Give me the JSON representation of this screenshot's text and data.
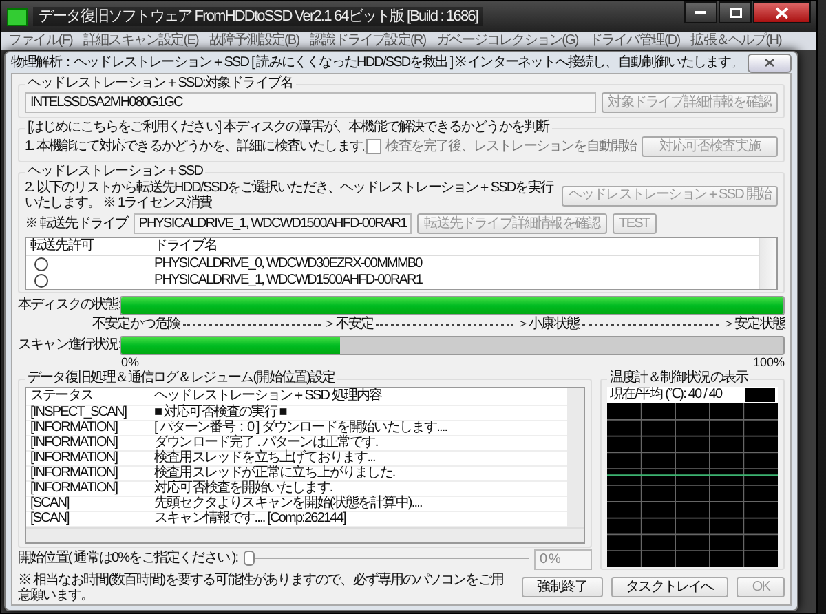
{
  "window": {
    "title": "データ復旧ソフトウェア FromHDDtoSSD Ver2.1 64ビット版 [Build : 1686]"
  },
  "menu": [
    "ファイル(F)",
    "詳細スキャン設定(E)",
    "故障予測設定(B)",
    "認識ドライブ設定(R)",
    "ガベージコレクション(G)",
    "ドライバ管理(D)",
    "拡張＆ヘルプ(H)"
  ],
  "dialog": {
    "title": "物理解析：ヘッドレストレーション＋SSD [ 読みにくくなったHDD/SSDを救出 ] ※ インターネットへ接続し、自動制御いたします。",
    "target": {
      "legend": "ヘッドレストレーション＋SSD:対象ドライブ名",
      "value": "INTELSSDSA2MH080G1GC",
      "button": {
        "label": "対象ドライブ詳細情報を確認",
        "disabled": true
      }
    },
    "inspect": {
      "legend": "[はじめにこちらをご利用ください] 本ディスクの障害が、本機能で解決できるかどうかを判断",
      "text": "1. 本機能にて対応できるかどうかを、詳細に検査いたします。",
      "checkbox": {
        "label": "検査を完了後、レストレーションを自動開始",
        "checked": false
      },
      "button": {
        "label": "対応可否検査実施",
        "disabled": true
      }
    },
    "restore": {
      "legend": "ヘッドレストレーション＋SSD",
      "text": "2. 以下のリストから転送先HDD/SSDをご選択いただき、ヘッドレストレーション＋SSDを実行いたします。 ※ 1ライセンス消費",
      "start_button": {
        "label": "ヘッドレストレーション＋SSD 開始",
        "disabled": true
      },
      "dest_label": "※ 転送先ドライブ",
      "dest_value": "PHYSICALDRIVE_1, WDCWD1500AHFD-00RAR1",
      "buttons": [
        {
          "label": "転送先ドライブ詳細情報を確認",
          "disabled": true
        },
        {
          "label": "TEST",
          "disabled": true
        }
      ],
      "table": {
        "columns": [
          "転送先許可",
          "ドライブ名"
        ],
        "rows": [
          {
            "selected": false,
            "drive": "PHYSICALDRIVE_0, WDCWD30EZRX-00MMMB0"
          },
          {
            "selected": false,
            "drive": "PHYSICALDRIVE_1, WDCWD1500AHFD-00RAR1"
          }
        ]
      }
    },
    "disk_state": {
      "label": "本ディスクの状態:",
      "level": 1,
      "scale": [
        "不安定かつ危険",
        "＞不安定",
        "＞小康状態",
        "＞安定状態"
      ]
    },
    "scan": {
      "label": "スキャン進行状況:",
      "level": 0.33,
      "min": "0%",
      "max": "100%"
    },
    "log": {
      "legend": "データ復旧処理＆通信ログ＆レジューム(開始位置)設定",
      "columns": [
        "ステータス",
        "ヘッドレストレーション＋SSD 処理内容"
      ],
      "rows": [
        {
          "status": "[INSPECT_SCAN]",
          "content": "■ 対応可否検査の実行 ■"
        },
        {
          "status": "[INFORMATION]",
          "content": "[ パターン番号：0 ] ダウンロードを開始いたします...."
        },
        {
          "status": "[INFORMATION]",
          "content": "ダウンロード完了 . パターンは正常です."
        },
        {
          "status": "[INFORMATION]",
          "content": "検査用スレッドを立ち上げております..."
        },
        {
          "status": "[INFORMATION]",
          "content": "検査用スレッドが正常に立ち上がりました."
        },
        {
          "status": "[INFORMATION]",
          "content": "対応可否検査を開始いたします."
        },
        {
          "status": "[SCAN]",
          "content": "先頭セクタよりスキャンを開始(状態を計算中)...."
        },
        {
          "status": "[SCAN]",
          "content": "スキャン情報です.... [Comp:262144]"
        }
      ]
    },
    "start_position": {
      "label": "開始位置( 通常は0%をご指定ください ):",
      "level": 0,
      "value": "0 %"
    },
    "temperature": {
      "legend": "温度計＆制御状況の表示",
      "reading": "現在/平均 (℃): 40 / 40"
    },
    "note": "※ 相当なお時間(数百時間)を要する可能性がありますので、必ず専用のパソコンをご用意願います。",
    "footer_buttons": [
      {
        "label": "強制終了",
        "disabled": false
      },
      {
        "label": "タスクトレイへ",
        "disabled": false
      },
      {
        "label": "OK",
        "disabled": true
      }
    ]
  }
}
